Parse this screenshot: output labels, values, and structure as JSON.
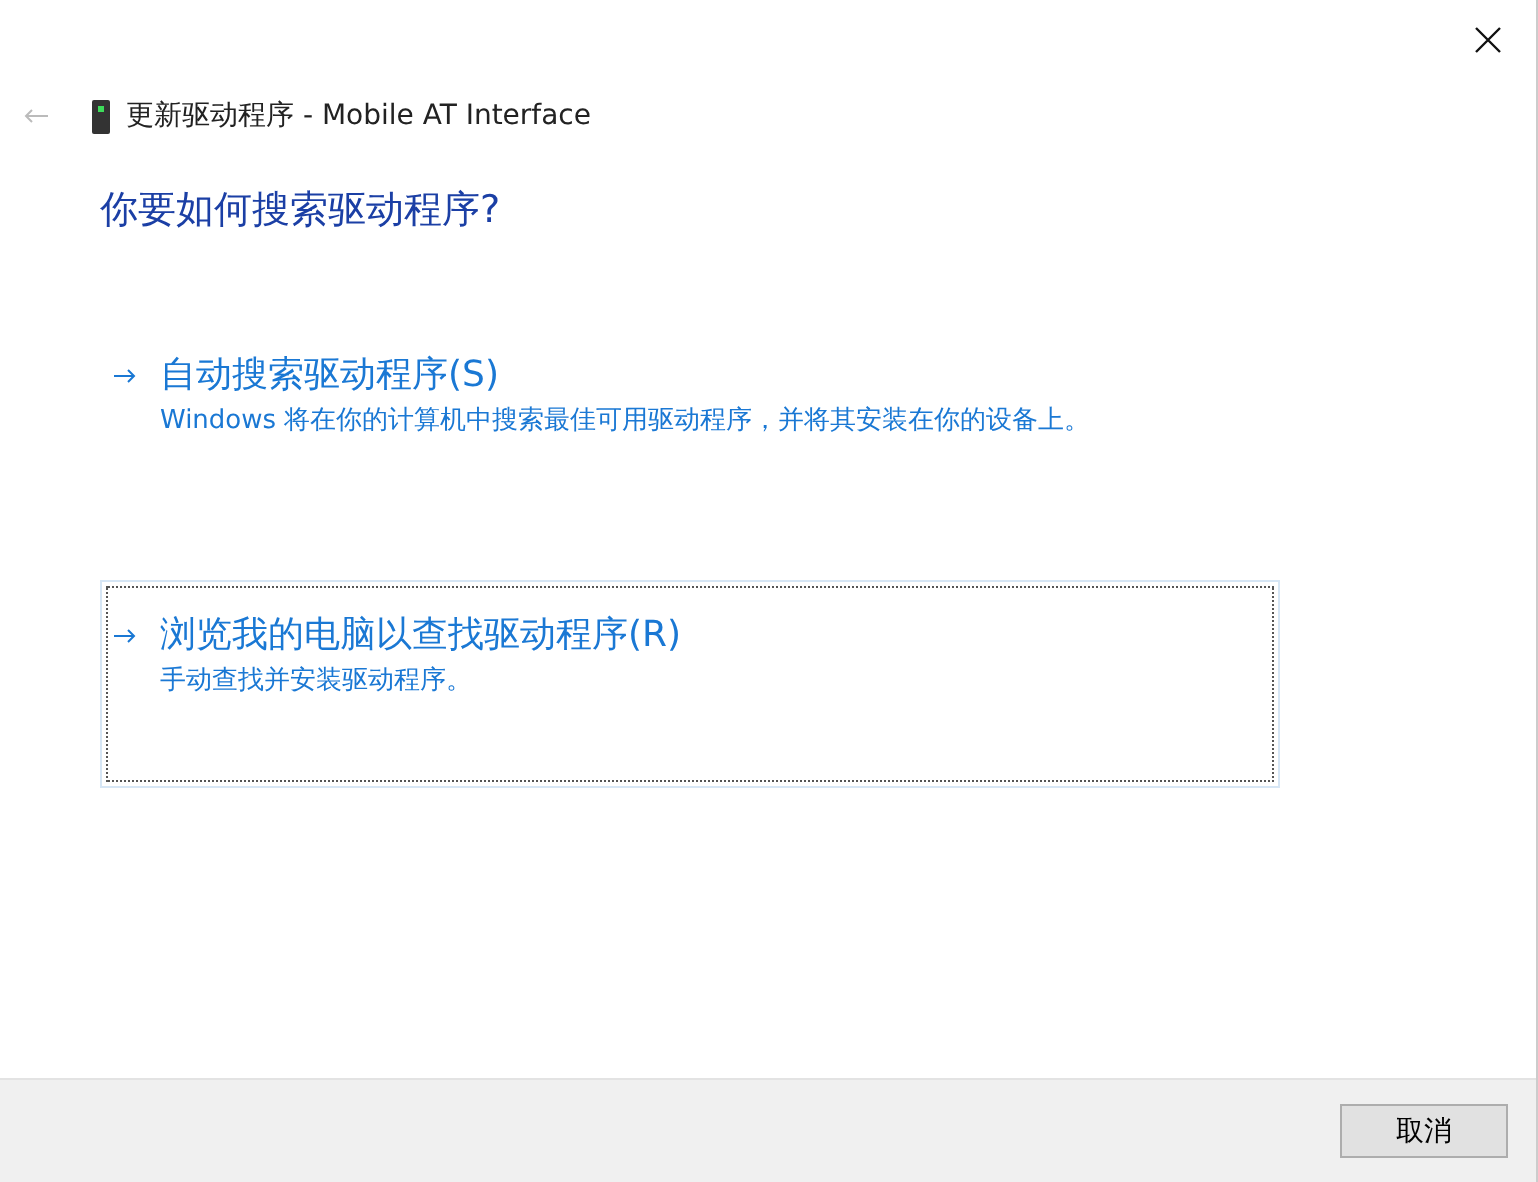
{
  "window": {
    "title": "更新驱动程序 - Mobile AT Interface"
  },
  "heading": "你要如何搜索驱动程序?",
  "options": [
    {
      "title": "自动搜索驱动程序(S)",
      "description": "Windows 将在你的计算机中搜索最佳可用驱动程序，并将其安装在你的设备上。",
      "selected": false
    },
    {
      "title": "浏览我的电脑以查找驱动程序(R)",
      "description": "手动查找并安装驱动程序。",
      "selected": true
    }
  ],
  "buttons": [
    "取消"
  ]
}
